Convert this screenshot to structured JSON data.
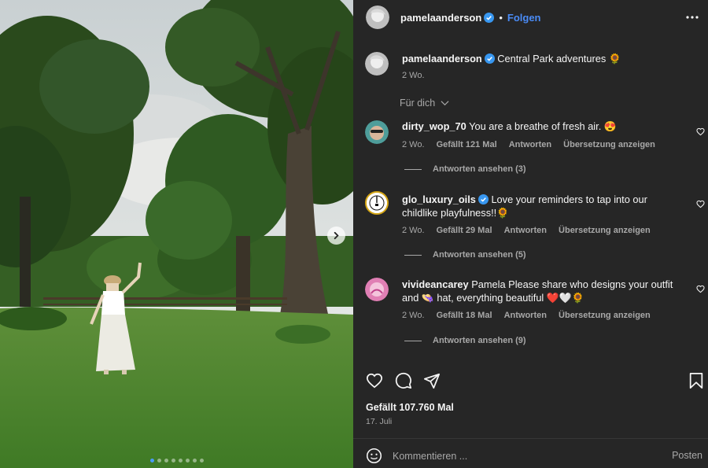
{
  "post": {
    "image_alt": "Person in hat and white skirt standing on grass in a park",
    "carousel": {
      "slide_count": 8,
      "active_index": 0
    }
  },
  "header": {
    "username": "pamelaanderson",
    "separator": "•",
    "follow_label": "Folgen"
  },
  "caption": {
    "username": "pamelaanderson",
    "text": "Central Park adventures 🌻",
    "time": "2 Wo."
  },
  "filter": {
    "label": "Für dich"
  },
  "comments": [
    {
      "username": "dirty_wop_70",
      "text": "You are a breathe of fresh air. 😍",
      "time": "2 Wo.",
      "likes": "Gefällt 121 Mal",
      "reply_label": "Antworten",
      "translate_label": "Übersetzung anzeigen",
      "replies_label": "Antworten ansehen (3)"
    },
    {
      "username": "glo_luxury_oils",
      "text": "Love your reminders to tap into our childlike playfulness!!🌻",
      "time": "2 Wo.",
      "likes": "Gefällt 29 Mal",
      "reply_label": "Antworten",
      "translate_label": "Übersetzung anzeigen",
      "replies_label": "Antworten ansehen (5)"
    },
    {
      "username": "vivideancarey",
      "text": "Pamela Please share who designs your outfit and 👒 hat, everything beautiful ❤️🤍🌻",
      "time": "2 Wo.",
      "likes": "Gefällt 18 Mal",
      "reply_label": "Antworten",
      "translate_label": "Übersetzung anzeigen",
      "replies_label": "Antworten ansehen (9)"
    }
  ],
  "footer": {
    "likes": "Gefällt 107.760 Mal",
    "date": "17. Juli",
    "comment_placeholder": "Kommentieren ...",
    "post_label": "Posten"
  },
  "colors": {
    "panel_bg": "#262626",
    "link_blue": "#4a8bf5",
    "muted": "#a8a8a8",
    "verified": "#3897f0"
  },
  "icons": [
    "verified-badge-icon",
    "more-icon",
    "heart-icon",
    "comment-icon",
    "share-icon",
    "bookmark-icon",
    "emoji-icon",
    "chevron-down-icon",
    "chevron-right-icon"
  ]
}
